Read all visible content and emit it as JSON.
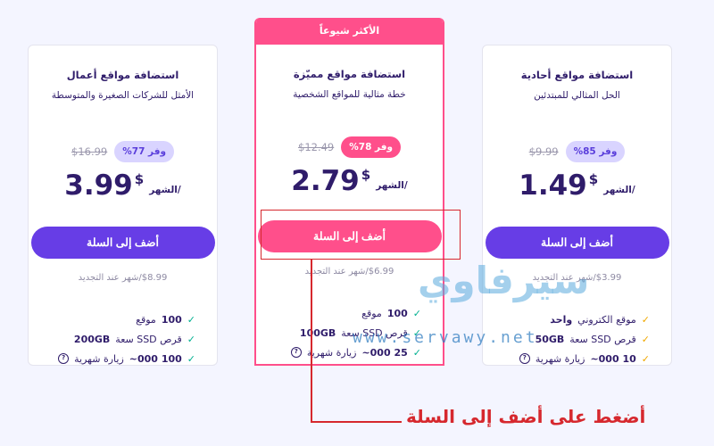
{
  "featured_label": "الأكثر شيوعاً",
  "plans": [
    {
      "title": "استضافة مواقع أعمال",
      "subtitle": "الأمثل للشركات الصغيرة والمتوسطة",
      "badge": "وفر 77%",
      "old_price": "$16.99",
      "price": "3.99",
      "currency": "$",
      "per_month": "/الشهر",
      "button": "أضف إلى السلة",
      "renewal": "$8.99/شهر عند التجديد",
      "features": [
        {
          "strong": "100",
          "text": "موقع"
        },
        {
          "strong": "200GB",
          "text": "قرص SSD سعة"
        },
        {
          "strong": "100 000~",
          "text": "زيارة شهرية"
        }
      ]
    },
    {
      "title": "استضافة مواقع مميّزة",
      "subtitle": "خطة مثالية للمواقع الشخصية",
      "badge": "وفر 78%",
      "old_price": "$12.49",
      "price": "2.79",
      "currency": "$",
      "per_month": "/الشهر",
      "button": "أضف إلى السلة",
      "renewal": "$6.99/شهر عند التجديد",
      "features": [
        {
          "strong": "100",
          "text": "موقع"
        },
        {
          "strong": "100GB",
          "text": "قرص SSD سعة"
        },
        {
          "strong": "25 000~",
          "text": "زيارة شهرية"
        }
      ]
    },
    {
      "title": "استضافة مواقع أحادية",
      "subtitle": "الحل المثالي للمبتدئين",
      "badge": "وفر 85%",
      "old_price": "$9.99",
      "price": "1.49",
      "currency": "$",
      "per_month": "/الشهر",
      "button": "أضف إلى السلة",
      "renewal": "$3.99/شهر عند التجديد",
      "features": [
        {
          "strong": "واحد",
          "text": "موقع الكتروني"
        },
        {
          "strong": "50GB",
          "text": "قرص SSD سعة"
        },
        {
          "strong": "10 000~",
          "text": "زيارة شهرية"
        }
      ]
    }
  ],
  "annotation": "أضغط على أضف إلى السلة",
  "watermark": {
    "arabic": "سيرفاوي",
    "url": "www.servawy.net"
  },
  "colors": {
    "primary": "#673de6",
    "featured": "#ff4f8b",
    "annotation": "#d6282e",
    "text": "#2f1c6a"
  }
}
